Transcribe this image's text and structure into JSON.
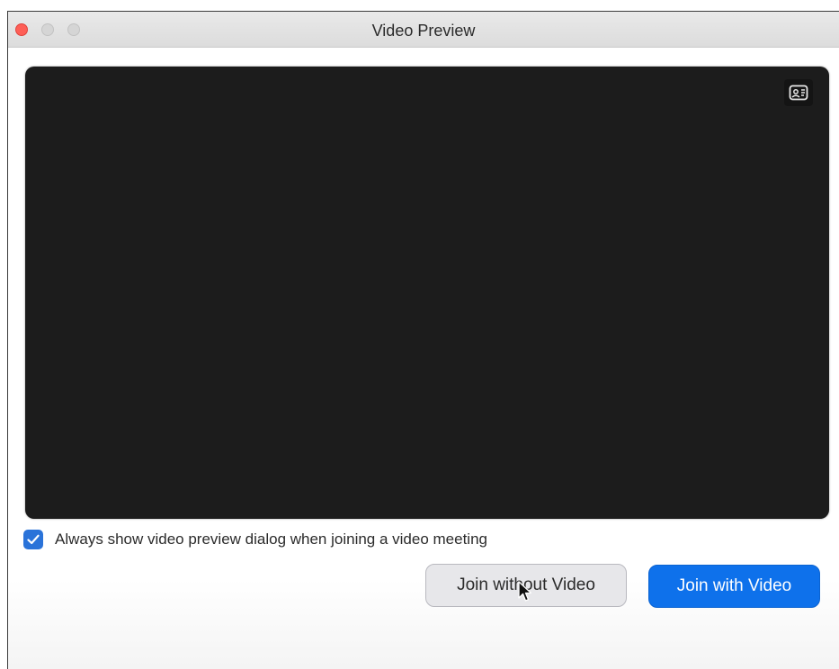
{
  "window": {
    "title": "Video Preview"
  },
  "preview": {
    "switch_icon": "camera-switch-icon"
  },
  "options": {
    "always_show_label": "Always show video preview dialog when joining a video meeting",
    "always_show_checked": true
  },
  "buttons": {
    "join_without_video": "Join without Video",
    "join_with_video": "Join with Video"
  },
  "colors": {
    "accent": "#0e71eb",
    "checkbox": "#2a73d9",
    "preview_bg": "#1c1c1c",
    "close_light": "#fe5f57"
  }
}
